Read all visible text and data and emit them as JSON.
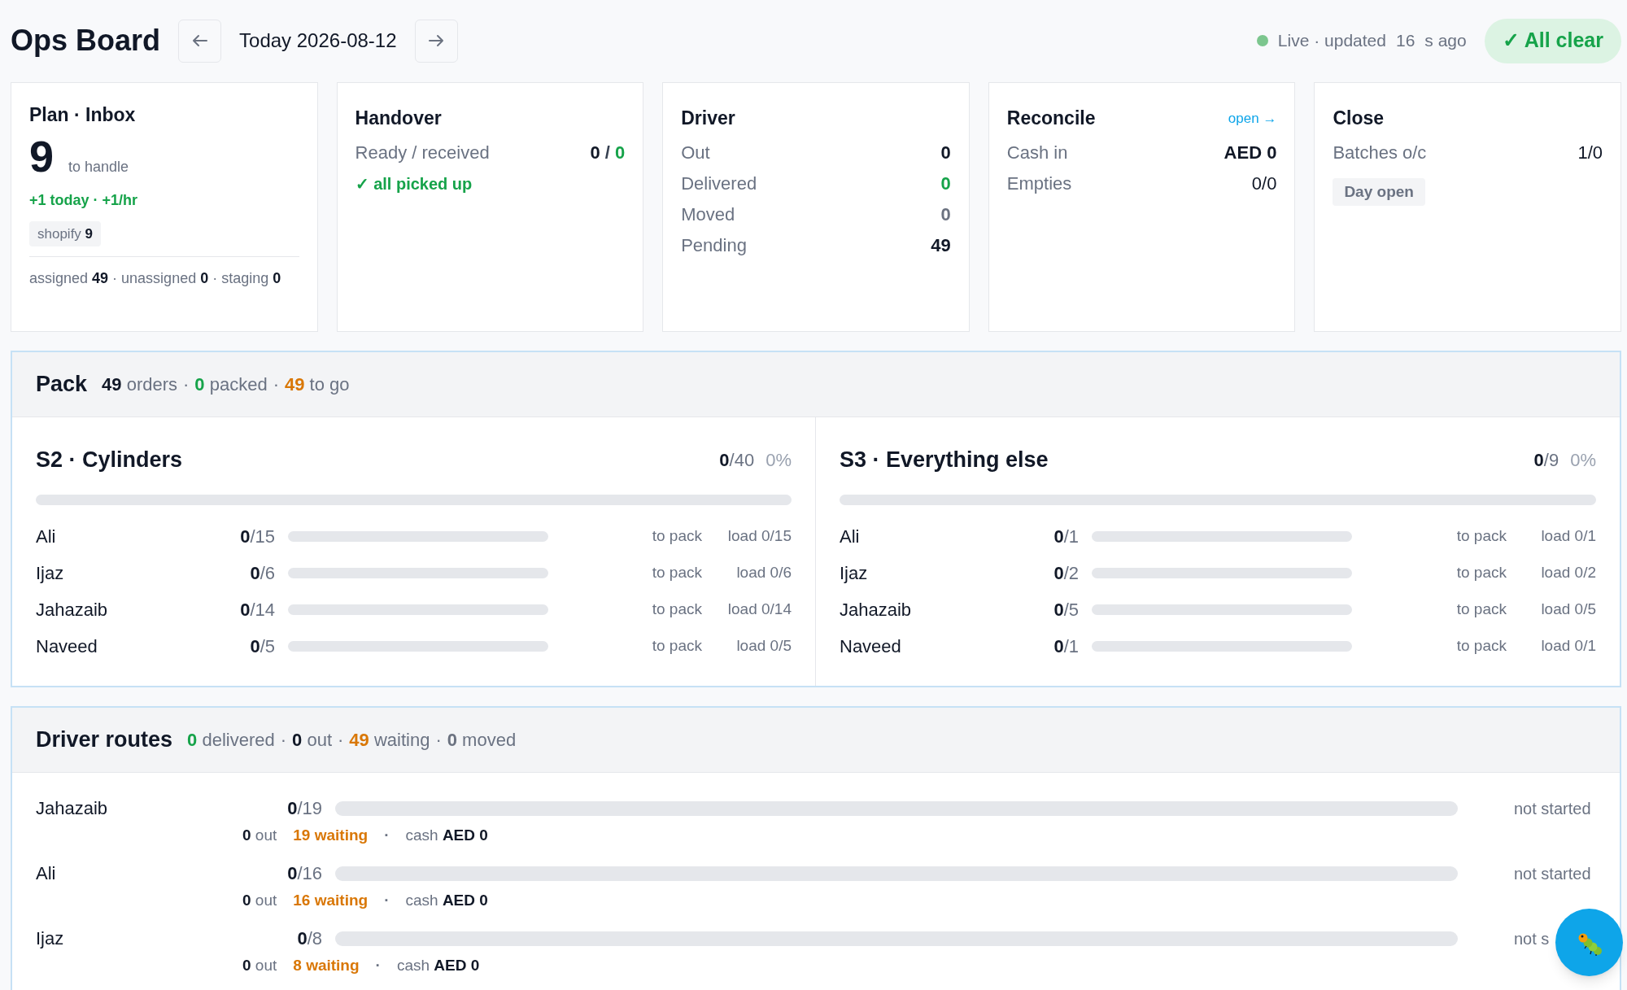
{
  "header": {
    "title": "Ops Board",
    "date": "Today 2026-08-12",
    "live": {
      "label": "Live · updated",
      "seconds": "16",
      "suffix": "s ago"
    },
    "status_badge": "✓ All clear"
  },
  "cards": [
    {
      "kind": "inbox",
      "title": "Plan · Inbox",
      "count": "9",
      "count_label": "to handle",
      "trend": "+1 today · +1/hr",
      "tags": [
        {
          "label": "shopify",
          "value": "9"
        }
      ],
      "footer": "assigned **49** · unassigned **0** · staging **0**"
    },
    {
      "kind": "rows",
      "title": "Handover",
      "rows": [
        {
          "label": "Ready / received",
          "strong": true,
          "parts": [
            {
              "text": "0",
              "color": "#111827"
            },
            {
              "text": "/",
              "color": "#374151"
            },
            {
              "text": "0",
              "color": "#16a34a"
            }
          ]
        }
      ],
      "note": "✓ all picked up"
    },
    {
      "kind": "rows",
      "title": "Driver",
      "rows": [
        {
          "label": "Out",
          "strong": true,
          "parts": [
            {
              "text": "0",
              "color": "#111827"
            }
          ]
        },
        {
          "label": "Delivered",
          "strong": true,
          "parts": [
            {
              "text": "0",
              "color": "#16a34a"
            }
          ]
        },
        {
          "label": "Moved",
          "strong": true,
          "parts": [
            {
              "text": "0",
              "color": "#6b7280"
            }
          ]
        },
        {
          "label": "Pending",
          "strong": true,
          "parts": [
            {
              "text": "49",
              "color": "#111827"
            }
          ]
        }
      ]
    },
    {
      "kind": "rows",
      "title": "Reconcile",
      "link": "open →",
      "rows": [
        {
          "label": "Cash in",
          "strong": true,
          "parts": [
            {
              "text": "AED 0",
              "color": "#111827"
            }
          ]
        },
        {
          "label": "Empties",
          "strong": false,
          "parts": [
            {
              "text": "0/0",
              "color": "#111827"
            }
          ]
        }
      ]
    },
    {
      "kind": "rows",
      "title": "Close",
      "rows": [
        {
          "label": "Batches o/c",
          "strong": false,
          "parts": [
            {
              "text": "1/0",
              "color": "#111827"
            }
          ]
        }
      ],
      "badge": "Day open"
    }
  ],
  "pack": {
    "title": "Pack",
    "summary": [
      {
        "count": "49",
        "noun": "orders",
        "color": "#111827"
      },
      {
        "separator": "·",
        "count": "0",
        "noun": "packed",
        "color": "#16a34a"
      },
      {
        "separator": "·",
        "count": "49",
        "noun": "to go",
        "color": "#d97706"
      }
    ],
    "stations": [
      {
        "title": "S2 · Cylinders",
        "done": "0",
        "total": "/40",
        "percent": "0%",
        "level": 0,
        "packers": [
          {
            "name": "Ali",
            "done": "0",
            "total": "/15",
            "level": 0,
            "status": "to pack",
            "load": "load 0/15"
          },
          {
            "name": "Ijaz",
            "done": "0",
            "total": "/6",
            "level": 0,
            "status": "to pack",
            "load": "load 0/6"
          },
          {
            "name": "Jahazaib",
            "done": "0",
            "total": "/14",
            "level": 0,
            "status": "to pack",
            "load": "load 0/14"
          },
          {
            "name": "Naveed",
            "done": "0",
            "total": "/5",
            "level": 0,
            "status": "to pack",
            "load": "load 0/5"
          }
        ]
      },
      {
        "title": "S3 · Everything else",
        "done": "0",
        "total": "/9",
        "percent": "0%",
        "level": 0,
        "packers": [
          {
            "name": "Ali",
            "done": "0",
            "total": "/1",
            "level": 0,
            "status": "to pack",
            "load": "load 0/1"
          },
          {
            "name": "Ijaz",
            "done": "0",
            "total": "/2",
            "level": 0,
            "status": "to pack",
            "load": "load 0/2"
          },
          {
            "name": "Jahazaib",
            "done": "0",
            "total": "/5",
            "level": 0,
            "status": "to pack",
            "load": "load 0/5"
          },
          {
            "name": "Naveed",
            "done": "0",
            "total": "/1",
            "level": 0,
            "status": "to pack",
            "load": "load 0/1"
          }
        ]
      }
    ]
  },
  "routes": {
    "title": "Driver routes",
    "summary": [
      {
        "count": "0",
        "noun": "delivered",
        "color": "#16a34a"
      },
      {
        "separator": "·",
        "count": "0",
        "noun": "out",
        "color": "#111827"
      },
      {
        "separator": "·",
        "count": "49",
        "noun": "waiting",
        "color": "#d97706"
      },
      {
        "separator": "·",
        "count": "0",
        "noun": "moved",
        "color": "#6b7280"
      }
    ],
    "drivers": [
      {
        "name": "Jahazaib",
        "done": "0",
        "total": "/19",
        "level": 0,
        "status": "not started",
        "out": "0",
        "out_label": "out",
        "waiting": "19 waiting",
        "dot": "·",
        "cash_label": "cash",
        "cash": "AED 0"
      },
      {
        "name": "Ali",
        "done": "0",
        "total": "/16",
        "level": 0,
        "status": "not started",
        "out": "0",
        "out_label": "out",
        "waiting": "16 waiting",
        "dot": "·",
        "cash_label": "cash",
        "cash": "AED 0"
      },
      {
        "name": "Ijaz",
        "done": "0",
        "total": "/8",
        "level": 0,
        "status": "not s",
        "out": "0",
        "out_label": "out",
        "waiting": "8 waiting",
        "dot": "·",
        "cash_label": "cash",
        "cash": "AED 0"
      }
    ]
  }
}
